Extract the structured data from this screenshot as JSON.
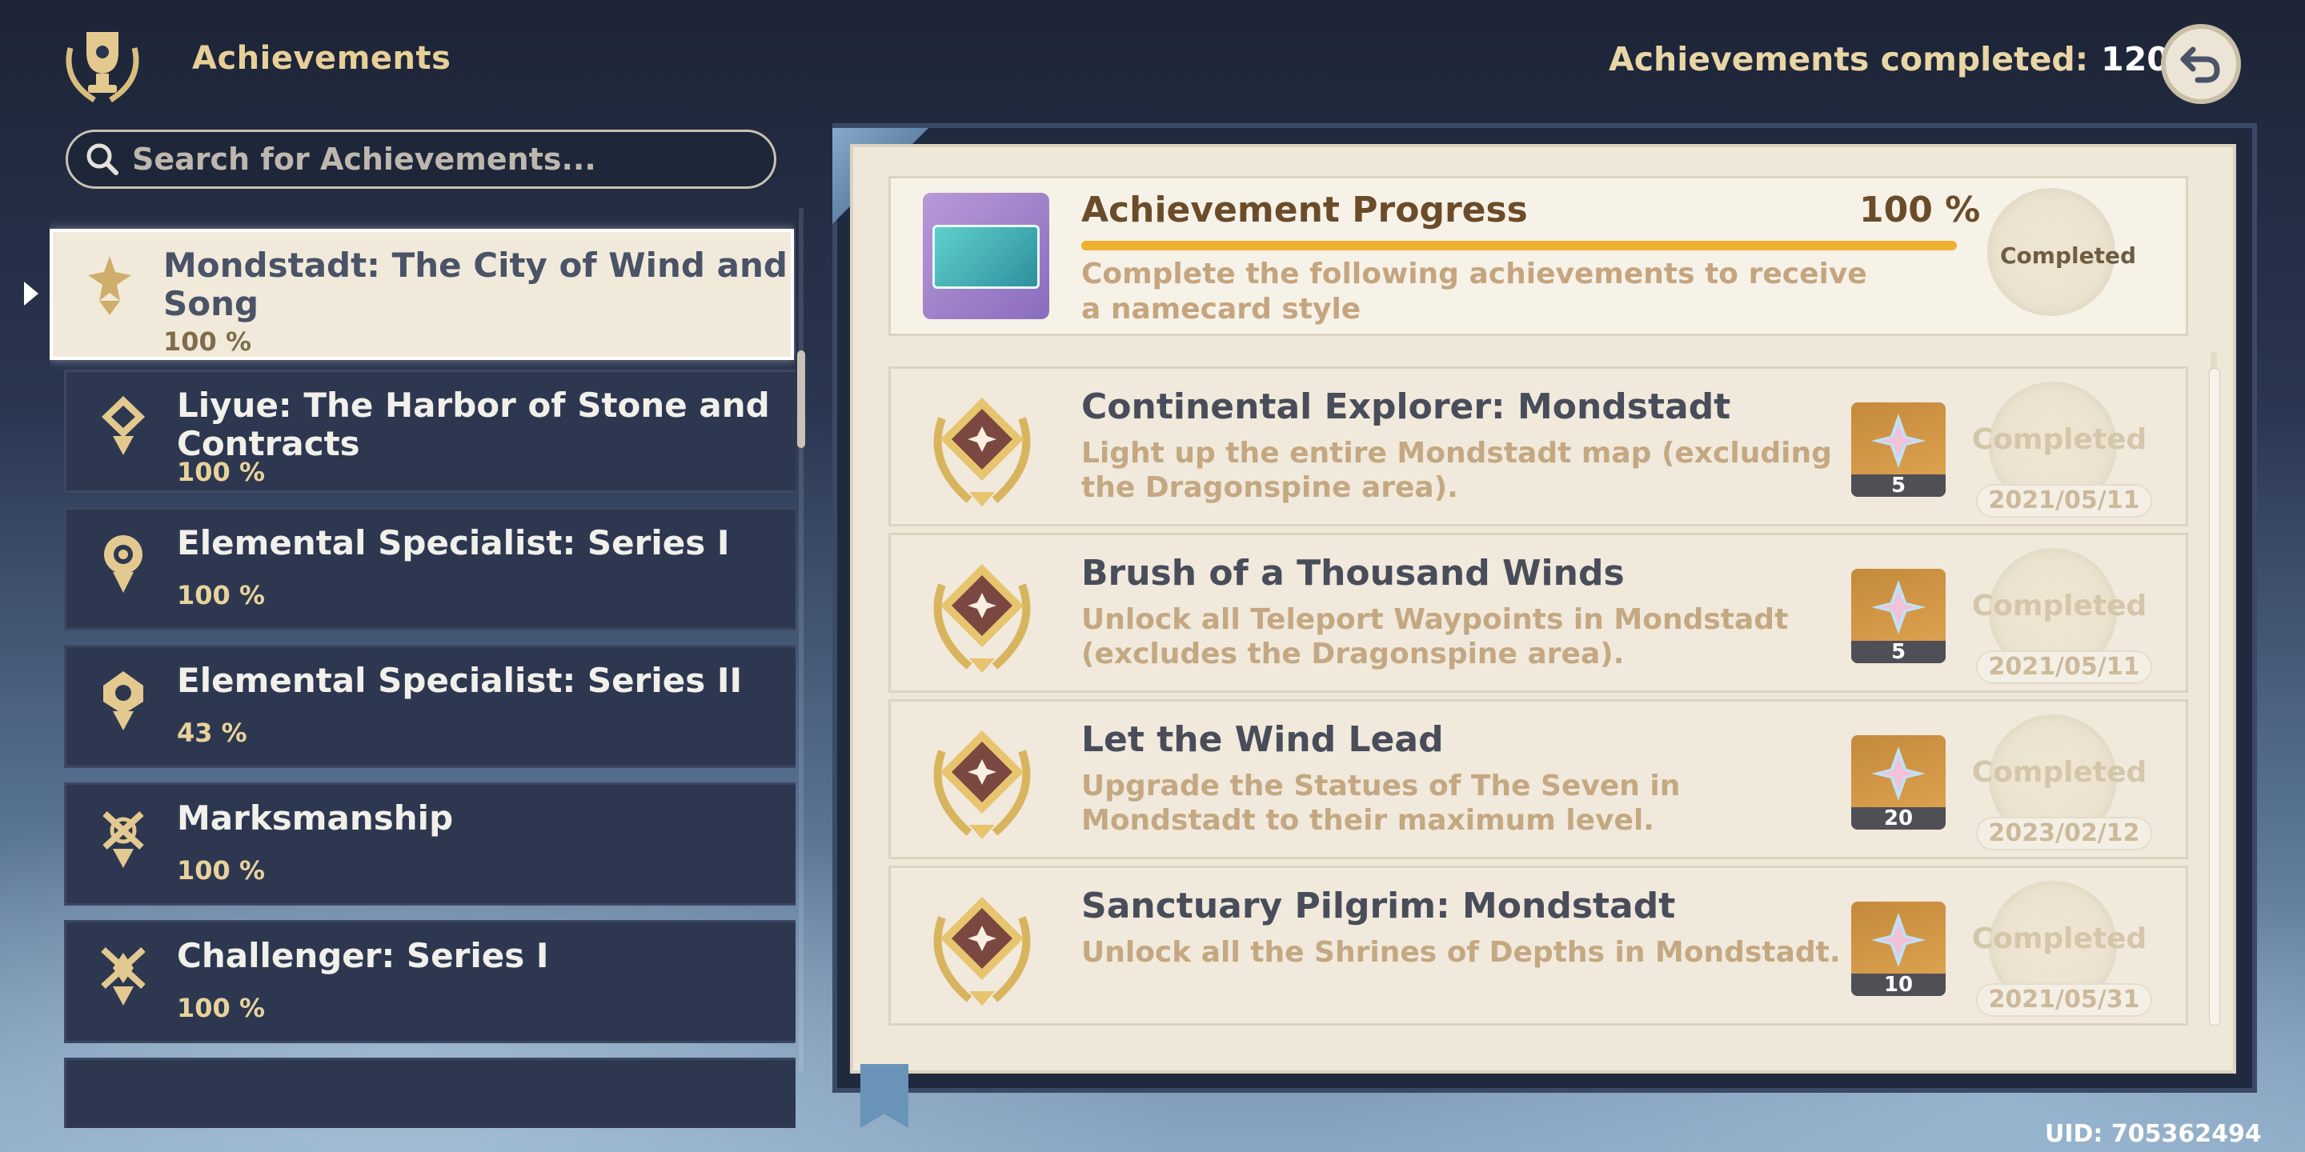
{
  "header": {
    "title": "Achievements",
    "completed_label": "Achievements completed:",
    "completed_count": "1204"
  },
  "search": {
    "placeholder": "Search for Achievements..."
  },
  "categories": [
    {
      "name": "Mondstadt: The City of Wind and Song",
      "percent": "100 %",
      "selected": true
    },
    {
      "name": "Liyue: The Harbor of Stone and Contracts",
      "percent": "100 %"
    },
    {
      "name": "Elemental Specialist: Series I",
      "percent": "100 %"
    },
    {
      "name": "Elemental Specialist: Series II",
      "percent": "43 %"
    },
    {
      "name": "Marksmanship",
      "percent": "100 %"
    },
    {
      "name": "Challenger: Series I",
      "percent": "100 %"
    }
  ],
  "progress": {
    "title": "Achievement Progress",
    "percent_label": "100 %",
    "fill_percent": 100,
    "description": "Complete the following achievements to receive a namecard style",
    "status": "Completed"
  },
  "achievements": [
    {
      "title": "Continental Explorer: Mondstadt",
      "description": "Light up the entire Mondstadt map (excluding the Dragonspine area).",
      "reward": "5",
      "status": "Completed",
      "date": "2021/05/11"
    },
    {
      "title": "Brush of a Thousand Winds",
      "description": "Unlock all Teleport Waypoints in Mondstadt (excludes the Dragonspine area).",
      "reward": "5",
      "status": "Completed",
      "date": "2021/05/11"
    },
    {
      "title": "Let the Wind Lead",
      "description": "Upgrade the Statues of The Seven in Mondstadt to their maximum level.",
      "reward": "20",
      "status": "Completed",
      "date": "2023/02/12"
    },
    {
      "title": "Sanctuary Pilgrim: Mondstadt",
      "description": "Unlock all the Shrines of Depths in Mondstadt.",
      "reward": "10",
      "status": "Completed",
      "date": "2021/05/31"
    }
  ],
  "uid": "UID: 705362494",
  "icons": {
    "emblem": "trophy-laurel-icon",
    "back": "back-arrow-icon",
    "search": "search-icon",
    "medal": "achievement-medal-icon",
    "reward": "primogem-icon"
  },
  "colors": {
    "accent": "#efb12f",
    "selected_bg": "#f1eadb",
    "panel_bg": "#2d3850",
    "title_gold": "#e7cf97"
  }
}
